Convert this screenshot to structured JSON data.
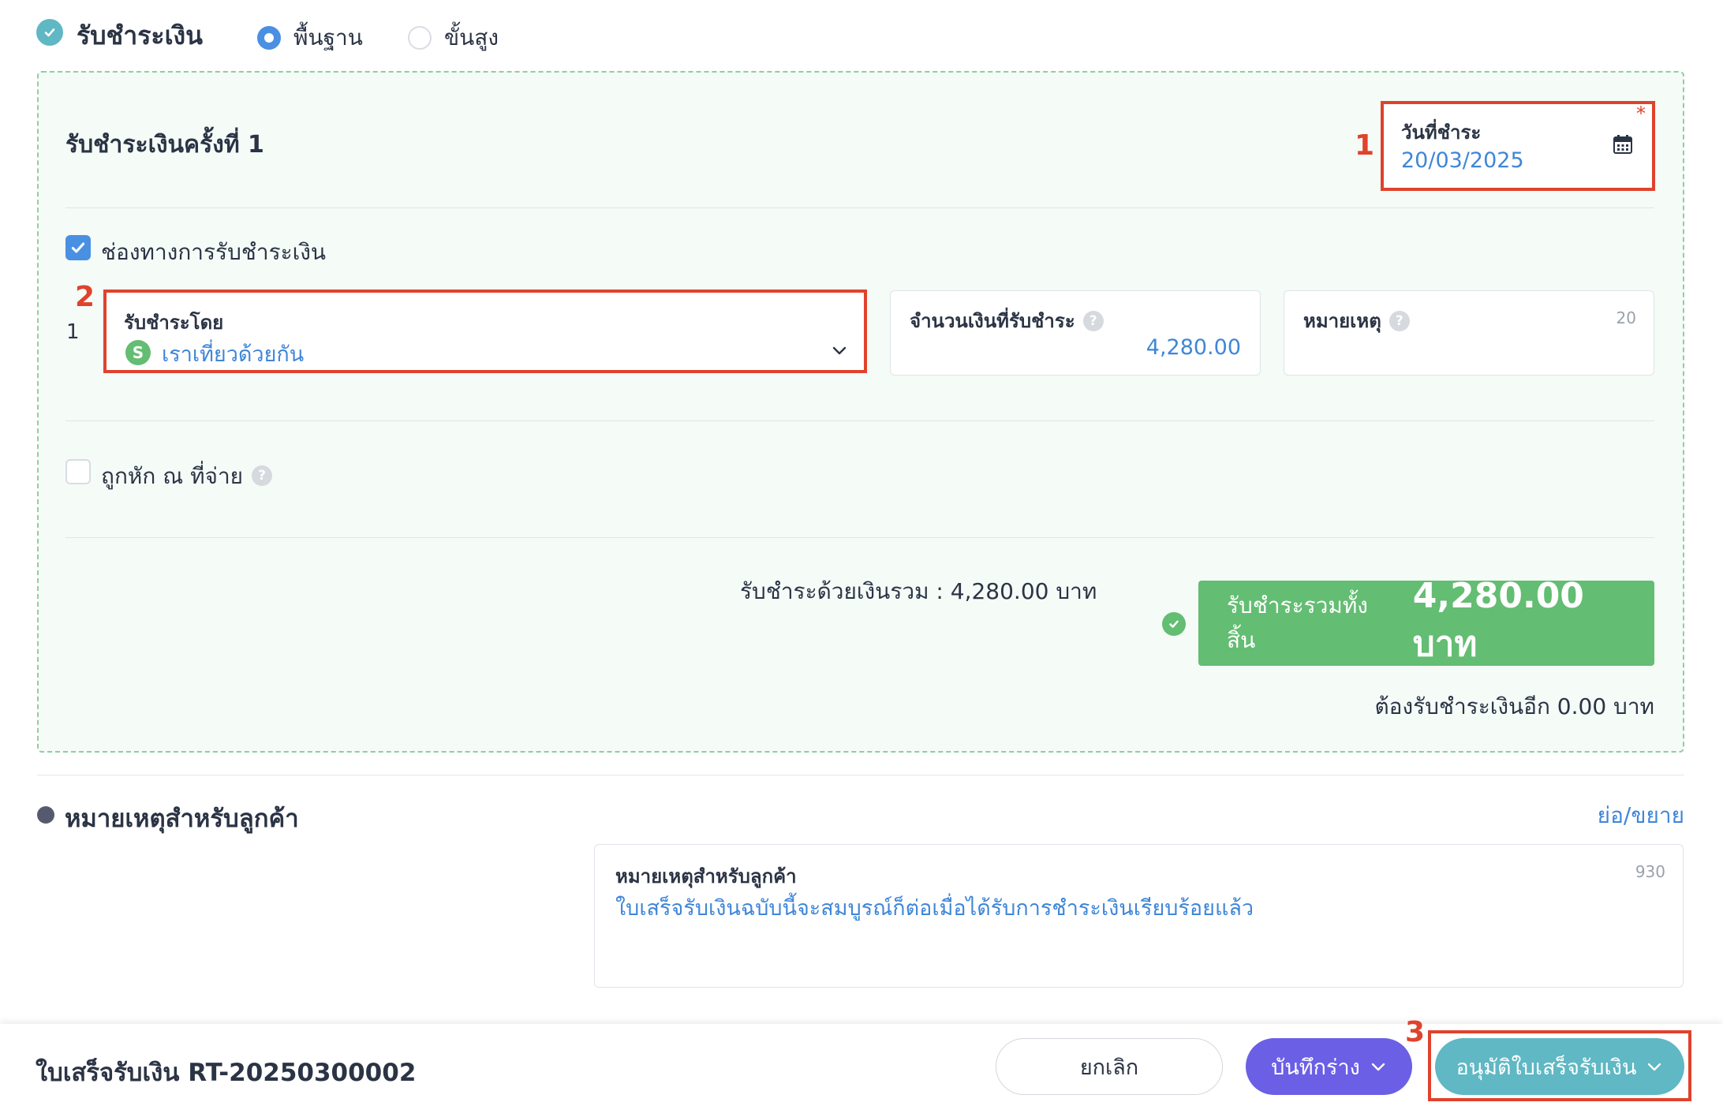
{
  "header": {
    "title": "รับชำระเงิน",
    "mode_basic": "พื้นฐาน",
    "mode_advanced": "ขั้นสูง",
    "selected_mode": "พื้นฐาน"
  },
  "payment": {
    "round_title": "รับชำระเงินครั้งที่ 1",
    "date_label": "วันที่ชำระ",
    "date_required_mark": "*",
    "date_value": "20/03/2025",
    "channel_label": "ช่องทางการรับชำระเงิน",
    "row_index": "1",
    "received_by_label": "รับชำระโดย",
    "received_by_avatar": "S",
    "received_by_value": "เราเที่ยวด้วยกัน",
    "amount_label": "จำนวนเงินที่รับชำระ",
    "amount_value": "4,280.00",
    "note_label": "หมายเหตุ",
    "note_counter": "20",
    "withholding_label": "ถูกหัก ณ ที่จ่าย",
    "sum_text": "รับชำระด้วยเงินรวม :  4,280.00 บาท",
    "total_label": "รับชำระรวมทั้งสิ้น",
    "total_value": "4,280.00 บาท",
    "remaining_text": "ต้องรับชำระเงินอีก 0.00 บาท"
  },
  "customer_note": {
    "section_title": "หมายเหตุสำหรับลูกค้า",
    "toggle_link": "ย่อ/ขยาย",
    "field_label": "หมายเหตุสำหรับลูกค้า",
    "counter": "930",
    "value": "ใบเสร็จรับเงินฉบับนี้จะสมบูรณ์ก็ต่อเมื่อได้รับการชำระเงินเรียบร้อยแล้ว"
  },
  "footer": {
    "doc_title": "ใบเสร็จรับเงิน RT-20250300002",
    "cancel_label": "ยกเลิก",
    "draft_label": "บันทึกร่าง",
    "approve_label": "อนุมัติใบเสร็จรับเงิน"
  },
  "annotations": {
    "marker_1": "1",
    "marker_2": "2",
    "marker_3": "3"
  },
  "colors": {
    "accent_blue": "#4a90e2",
    "link_blue": "#3f86d8",
    "green": "#63bd72",
    "teal": "#5fb8c4",
    "purple": "#6b5fe6",
    "highlight_red": "#e0422c"
  },
  "icons": [
    "check-circle-icon",
    "calendar-icon",
    "chevron-down-icon",
    "help-icon",
    "check-icon",
    "bullet-icon"
  ]
}
